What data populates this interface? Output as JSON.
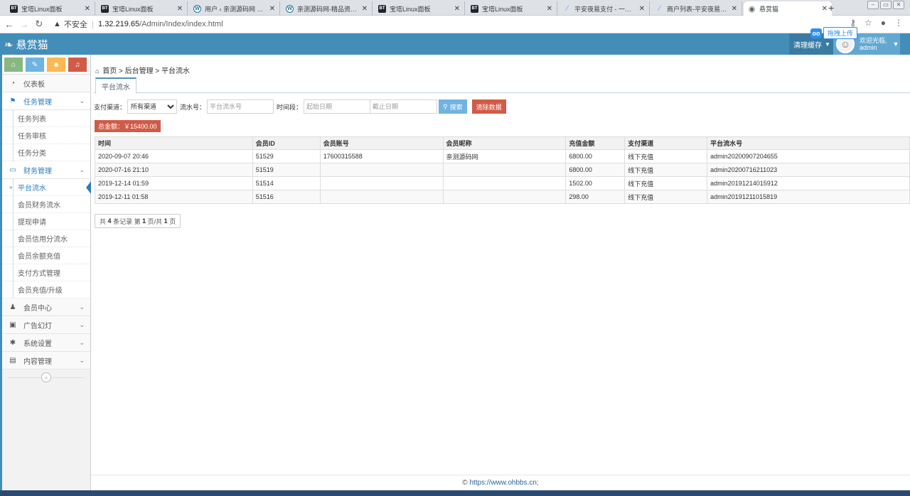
{
  "browser": {
    "tabs": [
      {
        "title": "宝塔Linux面板",
        "icon": "bt"
      },
      {
        "title": "宝塔Linux面板",
        "icon": "bt"
      },
      {
        "title": "用户 ‹ 亲测源码网 — W",
        "icon": "wp"
      },
      {
        "title": "亲测源码网-精品资源站",
        "icon": "wp"
      },
      {
        "title": "宝塔Linux面板",
        "icon": "bt"
      },
      {
        "title": "宝塔Linux面板",
        "icon": "bt"
      },
      {
        "title": "平安夜易支付 - 一站式",
        "icon": "pay"
      },
      {
        "title": "商户列表-平安夜易支付",
        "icon": "pay"
      },
      {
        "title": "悬赏猫",
        "icon": "globe"
      }
    ],
    "new_tab": "+",
    "insecure_label": "不安全",
    "url_host": "1.32.219.65",
    "url_path": "/Admin/Index/index.html"
  },
  "header": {
    "brand": "悬赏猫",
    "clear_cache": "清理缓存",
    "welcome": "欢迎光临,",
    "username": "admin",
    "upload_badge": "拖拽上传",
    "upload_icon_text": "oo"
  },
  "sidebar": {
    "items": [
      {
        "label": "仪表板",
        "icon": "dashboard-icon",
        "glyph": "◔",
        "type": "item"
      },
      {
        "label": "任务管理",
        "icon": "flag-icon",
        "glyph": "⚑",
        "type": "group",
        "open": true
      },
      {
        "label": "任务列表",
        "type": "sub"
      },
      {
        "label": "任务审核",
        "type": "sub"
      },
      {
        "label": "任务分类",
        "type": "sub"
      },
      {
        "label": "财务管理",
        "icon": "wallet-icon",
        "glyph": "▭",
        "type": "group",
        "open": true
      },
      {
        "label": "平台流水",
        "type": "sub",
        "active": true
      },
      {
        "label": "会员财务流水",
        "type": "sub"
      },
      {
        "label": "提现申请",
        "type": "sub"
      },
      {
        "label": "会员信用分流水",
        "type": "sub"
      },
      {
        "label": "会员余额充值",
        "type": "sub"
      },
      {
        "label": "支付方式管理",
        "type": "sub"
      },
      {
        "label": "会员充值/升级",
        "type": "sub"
      },
      {
        "label": "会员中心",
        "icon": "user-icon",
        "glyph": "♟",
        "type": "group"
      },
      {
        "label": "广告幻灯",
        "icon": "image-icon",
        "glyph": "▣",
        "type": "group"
      },
      {
        "label": "系统设置",
        "icon": "gear-icon",
        "glyph": "✱",
        "type": "group"
      },
      {
        "label": "内容管理",
        "icon": "book-icon",
        "glyph": "▤",
        "type": "group"
      }
    ]
  },
  "breadcrumb": {
    "home": "首页",
    "sep": ">",
    "level1": "后台管理",
    "level2": "平台流水"
  },
  "tab_label": "平台流水",
  "filters": {
    "channel_label": "支付渠道：",
    "channel_selected": "所有渠道",
    "serial_label": "流水号：",
    "serial_placeholder": "平台流水号",
    "period_label": "时间段：",
    "start_placeholder": "起始日期",
    "end_placeholder": "截止日期",
    "search_label": "搜索",
    "clear_label": "清除数据"
  },
  "total_label": "总金额：￥15400.00",
  "table": {
    "columns": [
      "时间",
      "会员ID",
      "会员账号",
      "会员昵称",
      "充值金额",
      "支付渠道",
      "平台流水号"
    ],
    "rows": [
      [
        "2020-09-07 20:46",
        "51529",
        "17600315588",
        "亲测源码网",
        "6800.00",
        "线下充值",
        "admin20200907204655"
      ],
      [
        "2020-07-16 21:10",
        "51519",
        "",
        "",
        "6800.00",
        "线下充值",
        "admin20200716211023"
      ],
      [
        "2019-12-14 01:59",
        "51514",
        "",
        "",
        "1502.00",
        "线下充值",
        "admin20191214015912"
      ],
      [
        "2019-12-11 01:58",
        "51516",
        "",
        "",
        "298.00",
        "线下充值",
        "admin20191211015819"
      ]
    ]
  },
  "pager": {
    "prefix": "共",
    "count": "4",
    "mid": "条记录 第",
    "page": "1",
    "mid2": "页/共",
    "pages": "1",
    "suffix": "页"
  },
  "footer": {
    "symbol": "©",
    "link": "https://www.ohbbs.cn;"
  },
  "colors": {
    "header": "#438eb9",
    "accent": "#2b7dbc",
    "danger": "#d15b47",
    "search": "#6fb3e0"
  },
  "shortcut_colors": [
    "#87b87f",
    "#6fb3e0",
    "#ffb752",
    "#d15b47"
  ]
}
